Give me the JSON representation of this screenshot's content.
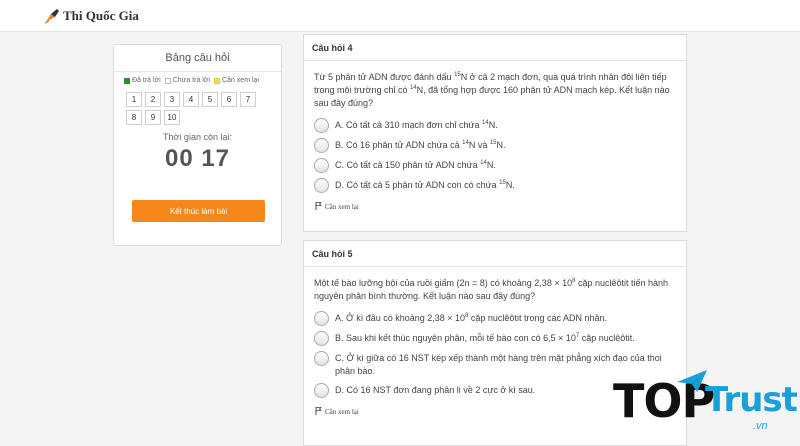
{
  "header": {
    "logo_text": "Thi Quốc Gia",
    "logo_icon": "pen-nib-icon"
  },
  "sidebar": {
    "title": "Bảng câu hỏi",
    "legend": [
      {
        "label": "Đã trả lời",
        "color": "#2e8b2e"
      },
      {
        "label": "Chưa trả lời",
        "color": "#ffffff"
      },
      {
        "label": "Cần xem lại",
        "color": "#f2e04a"
      }
    ],
    "questions": [
      "1",
      "2",
      "3",
      "4",
      "5",
      "6",
      "7",
      "8",
      "9",
      "10"
    ],
    "timer_label": "Thời gian còn lại:",
    "timer": "00 17",
    "finish_button": "Kết thúc làm bài"
  },
  "q4": {
    "header": "Câu hỏi 4",
    "stem": [
      "Từ 5 phân tử ADN được đánh dấu ",
      "15",
      "N ở cả 2 mạch đơn, qua quá trình nhân đôi liên tiếp trong môi trường chỉ có ",
      "14",
      "N, đã tổng hợp được 160 phân tử ADN mạch kép. Kết luận nào sau đây đúng?"
    ],
    "options": [
      [
        "A. Có tất cả 310 mạch đơn chỉ chứa ",
        "14",
        "N."
      ],
      [
        "B. Có 16 phân tử ADN chứa cả ",
        "14",
        "N và ",
        "15",
        "N."
      ],
      [
        "C. Có tất cả 150 phân tử ADN chứa ",
        "14",
        "N."
      ],
      [
        "D. Có tất cả 5 phân tử ADN con có chứa ",
        "15",
        "N."
      ]
    ],
    "review": "Cần xem lại"
  },
  "q5": {
    "header": "Câu hỏi 5",
    "stem": [
      "Một tế bào lưỡng bội của ruồi giấm (2n = 8) có khoảng 2,38 × 10",
      "8",
      " cặp nuclêôtit tiến hành nguyên phân bình thường. Kết luận nào sau đây đúng?"
    ],
    "options": [
      [
        "A. Ở kì đầu có khoảng 2,38 × 10",
        "8",
        " cặp nuclêôtit trong các ADN nhân."
      ],
      [
        "B. Sau khi kết thúc nguyên phân, mỗi tế bào con có 6,5 × 10",
        "7",
        " cặp nuclêôtit."
      ],
      [
        "C. Ở kì giữa có 16 NST kép xếp thành một hàng trên mặt phẳng xích đạo của thoi phân bào."
      ],
      [
        "D. Có 16 NST đơn đang phân li về 2 cực ở kì sau."
      ]
    ],
    "review": "Cần xem lại"
  },
  "watermark": {
    "top": "TOP",
    "trust": "Trust",
    "domain": ".vn",
    "accent": "#1aa0d8"
  }
}
